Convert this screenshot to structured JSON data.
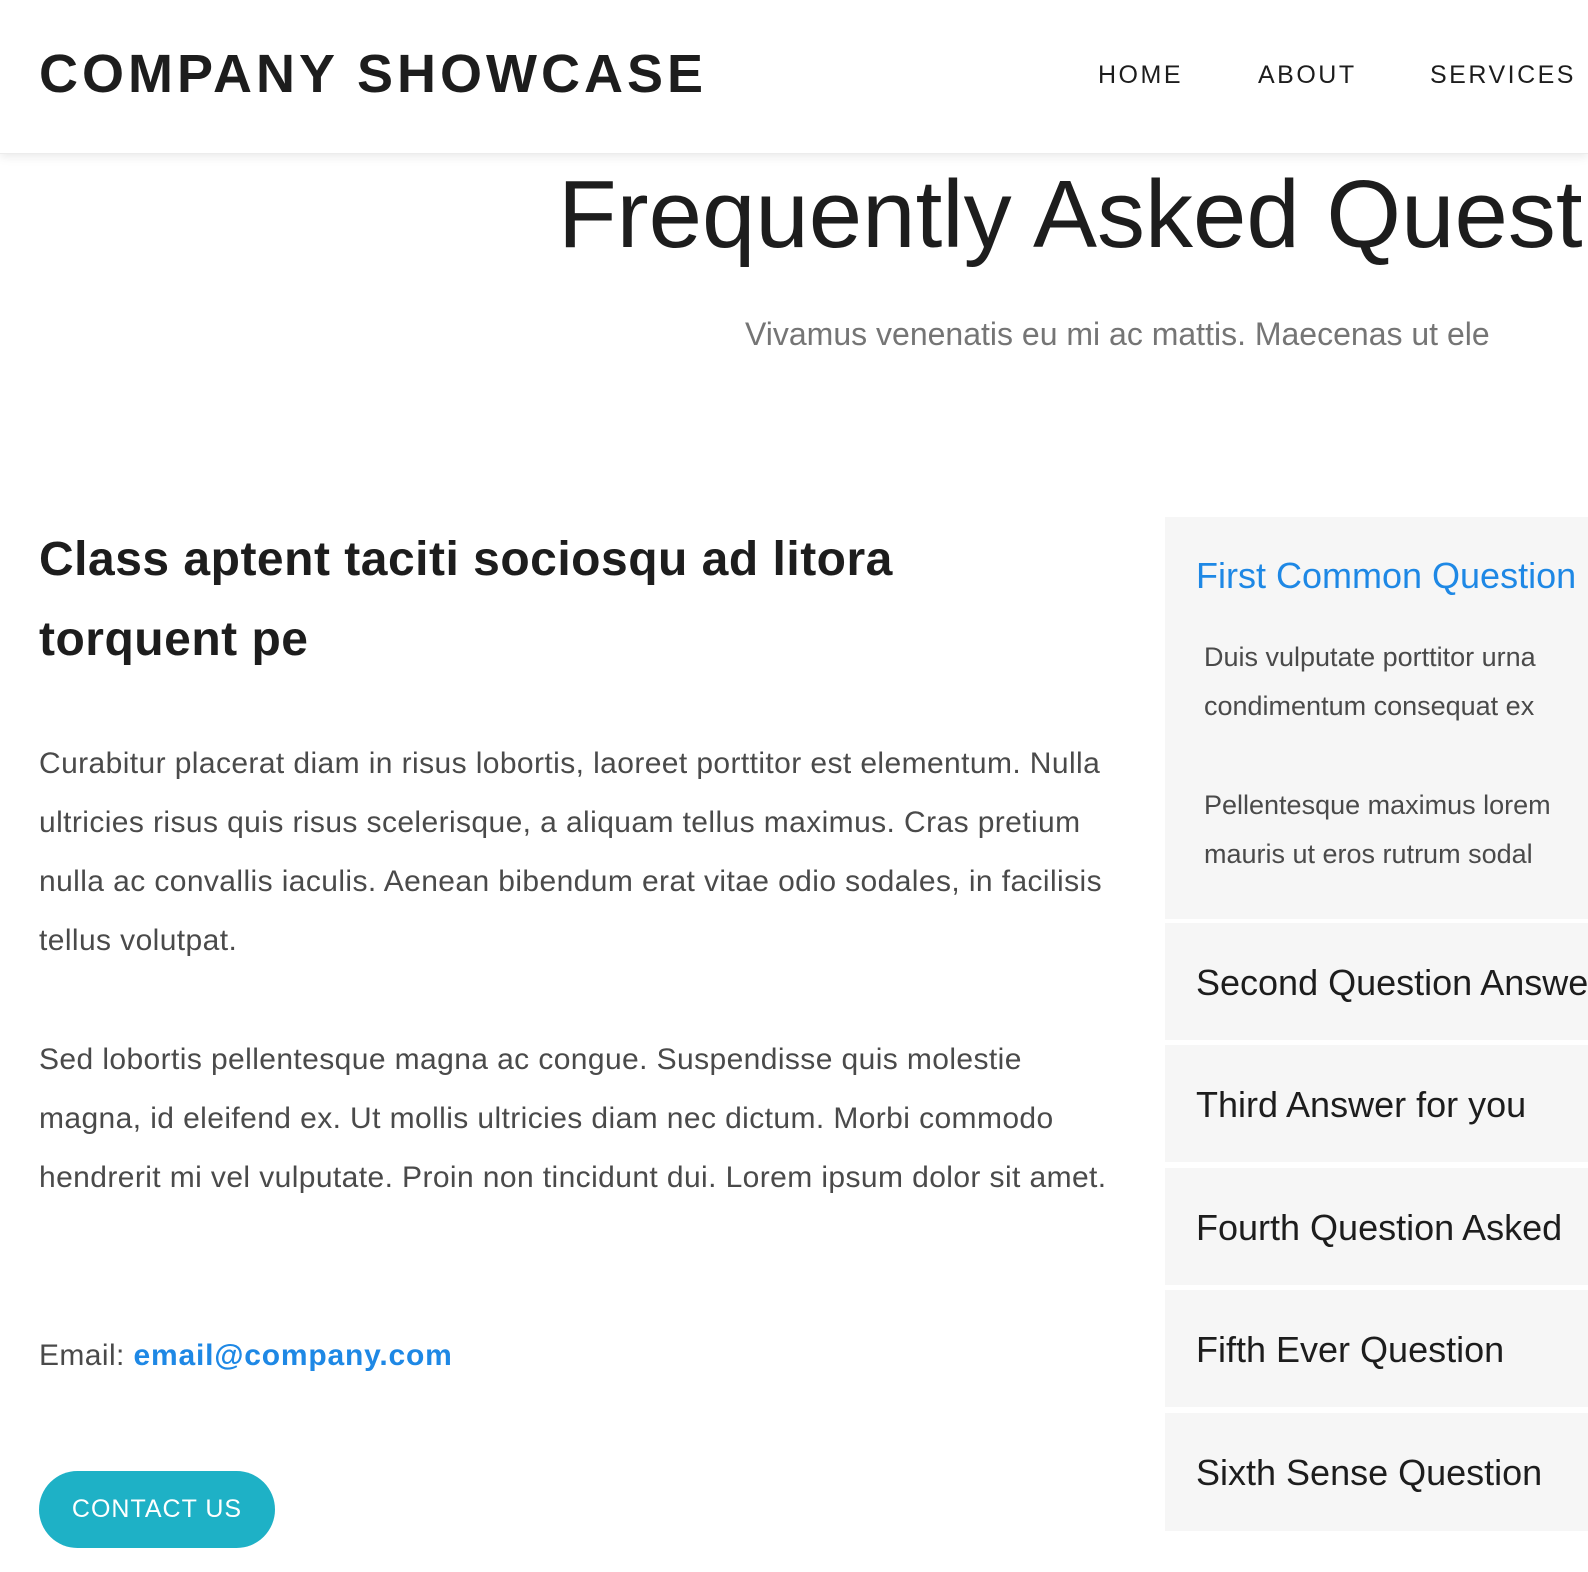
{
  "header": {
    "brand": "COMPANY SHOWCASE",
    "nav": [
      "HOME",
      "ABOUT",
      "SERVICES"
    ]
  },
  "hero": {
    "title": "Frequently Asked Questions",
    "subtitle": "Vivamus venenatis eu mi ac mattis. Maecenas ut ele"
  },
  "left": {
    "heading": "Class aptent taciti sociosqu ad litora torquent pe",
    "paragraph1": "Curabitur placerat diam in risus lobortis, laoreet porttitor est elementum. Nulla ultricies risus quis risus scelerisque, a aliquam tellus maximus. Cras pretium nulla ac convallis iaculis. Aenean bibendum erat vitae odio sodales, in facilisis tellus volutpat.",
    "paragraph2": "Sed lobortis pellentesque magna ac congue. Suspendisse quis molestie magna, id eleifend ex. Ut mollis ultricies diam nec dictum. Morbi commodo hendrerit mi vel vulputate. Proin non tincidunt dui. Lorem ipsum dolor sit amet.",
    "email_label": "Email:",
    "email": "email@company.com",
    "contact_button": "CONTACT US"
  },
  "accordion": {
    "open_item": {
      "question": "First Common Question",
      "answer_lines_1": [
        "Duis vulputate porttitor urna",
        "condimentum consequat ex"
      ],
      "answer_lines_2": [
        "Pellentesque maximus lorem",
        "mauris ut eros rutrum sodal"
      ]
    },
    "items": [
      "Second Question Answers",
      "Third Answer for you",
      "Fourth Question Asked",
      "Fifth Ever Question",
      "Sixth Sense Question"
    ]
  },
  "colors": {
    "accent": "#1e88e5",
    "button": "#1eb1c6",
    "panel": "#f6f6f6"
  }
}
